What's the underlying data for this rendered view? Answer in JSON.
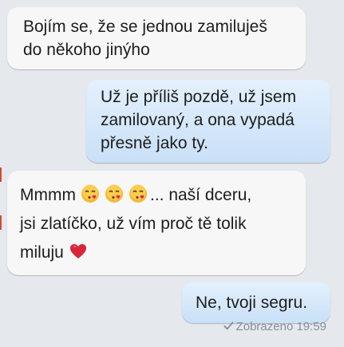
{
  "messages": [
    {
      "direction": "incoming",
      "lines": [
        "Bojím se, že se jednou zamiluješ",
        "do někoho jinýho"
      ]
    },
    {
      "direction": "outgoing",
      "lines": [
        "Už je příliš pozdě, už jsem",
        "zamilovaný, a ona vypadá",
        "přesně jako ty."
      ]
    },
    {
      "direction": "incoming",
      "lines": [
        "Mmmm",
        "... naší dceru,",
        "jsi zlatíčko, už vím proč tě tolik",
        "miluju"
      ]
    },
    {
      "direction": "outgoing",
      "lines": [
        "Ne, tvoji segru."
      ]
    }
  ],
  "status": {
    "text": "Zobrazeno 19:59",
    "icon": "checkmark-icon"
  },
  "icons": {
    "kiss": "kissing-face-emoji",
    "heart": "red-heart-emoji"
  }
}
